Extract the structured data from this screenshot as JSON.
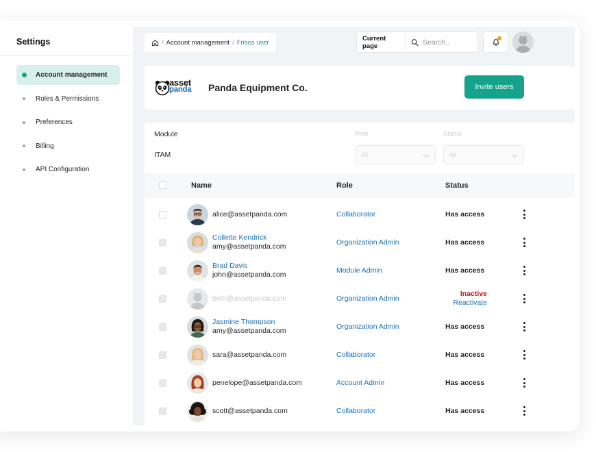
{
  "sidebar": {
    "title": "Settings",
    "items": [
      {
        "label": "Account management",
        "active": true
      },
      {
        "label": "Roles & Permissions"
      },
      {
        "label": "Preferences"
      },
      {
        "label": "Billing"
      },
      {
        "label": "API Configuration"
      }
    ]
  },
  "header": {
    "breadcrumb": {
      "parent": "Account management",
      "separator": "/",
      "current": "Frisco user"
    },
    "search": {
      "scope": "Current page",
      "placeholder": "Search.."
    }
  },
  "company": {
    "logo_line1": "asset",
    "logo_line2": "panda",
    "name": "Panda Equipment Co.",
    "invite_label": "Invite users"
  },
  "filters": {
    "module_label": "Module",
    "module_value": "ITAM",
    "role_label": "Role",
    "role_value": "All",
    "status_label": "Status",
    "status_value": "All"
  },
  "table": {
    "headers": {
      "name": "Name",
      "role": "Role",
      "status": "Status"
    },
    "rows": [
      {
        "name": "",
        "email": "alice@assetpanda.com",
        "role": "Collaborator",
        "status": "Has access",
        "avatar": "man-glasses"
      },
      {
        "name": "Collette Kendrick",
        "email": "amy@assetpanda.com",
        "role": "Organization Admin",
        "status": "Has access",
        "avatar": "woman-blonde"
      },
      {
        "name": "Brad Davis",
        "email": "john@assetpanda.com",
        "role": "Module Admin",
        "status": "Has access",
        "avatar": "man-dark"
      },
      {
        "name": "",
        "email": "beth@assetpanda.com",
        "role": "Organization Admin",
        "status": "Inactive",
        "action": "Reactivate",
        "avatar": "placeholder"
      },
      {
        "name": "Jasmine Thompson",
        "email": "amy@assetpanda.com",
        "role": "Organization Admin",
        "status": "Has access",
        "avatar": "woman-dark"
      },
      {
        "name": "",
        "email": "sara@assetpanda.com",
        "role": "Collaborator",
        "status": "Has access",
        "avatar": "woman-blonde"
      },
      {
        "name": "",
        "email": "penelope@assetpanda.com",
        "role": "Account Admin",
        "status": "Has access",
        "avatar": "woman-red"
      },
      {
        "name": "",
        "email": "scott@assetpanda.com",
        "role": "Collaborator",
        "status": "Has access",
        "avatar": "woman-curly"
      }
    ]
  },
  "colors": {
    "accent": "#16a38c",
    "link": "#1a6fb2",
    "inactive": "#c0141a",
    "notification": "#f09a1a"
  }
}
